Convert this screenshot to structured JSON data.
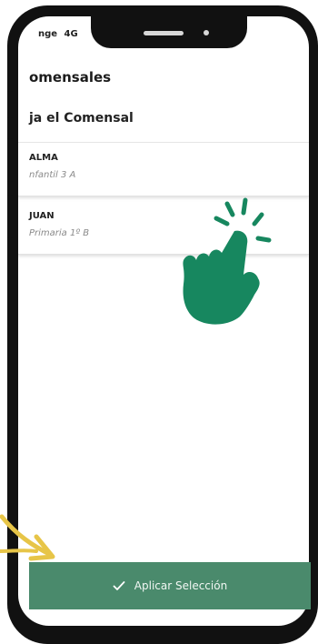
{
  "colors": {
    "accent": "#4a8a6c",
    "hand": "#17875f",
    "arrow": "#e7c548",
    "phone_frame": "#111111"
  },
  "status_bar": {
    "carrier": "nge",
    "network": "4G"
  },
  "page": {
    "title": "omensales"
  },
  "section": {
    "header": "ja el Comensal"
  },
  "diners": [
    {
      "name": "ALMA",
      "class": "nfantil 3 A"
    },
    {
      "name": "JUAN",
      "class": "Primaria 1º B"
    }
  ],
  "apply_button": {
    "label": "Aplicar Selección",
    "icon": "check-icon"
  },
  "overlays": {
    "hand_icon": "tap-hand-icon",
    "arrow_icon": "curved-arrow-icon"
  }
}
